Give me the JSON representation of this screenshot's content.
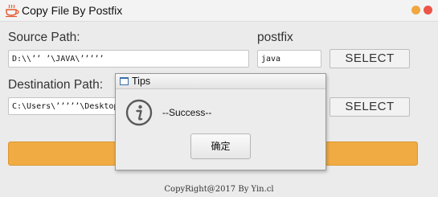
{
  "window": {
    "title": "Copy File By Postfix",
    "app_icon": "coffee-cup-icon",
    "controls": [
      "minimize",
      "close"
    ],
    "colors": {
      "minimize": "#f1a640",
      "close": "#eb5448"
    }
  },
  "source": {
    "label": "Source Path:",
    "value": "D:\\\\’’         ’\\JAVA\\’’’’’ "
  },
  "postfix": {
    "label": "postfix",
    "value": "java",
    "select_label": "SELECT"
  },
  "destination": {
    "label": "Destination Path:",
    "value": "C:\\Users\\’’’’’\\Desktop",
    "select_label": "SELECT"
  },
  "run_button": {
    "label": "",
    "color": "#f0ac42"
  },
  "footer": {
    "text": "CopyRight@2017  By Yin.cl"
  },
  "dialog": {
    "title": "Tips",
    "icon": "info-icon",
    "message": "--Success--",
    "ok_label": "确定"
  }
}
